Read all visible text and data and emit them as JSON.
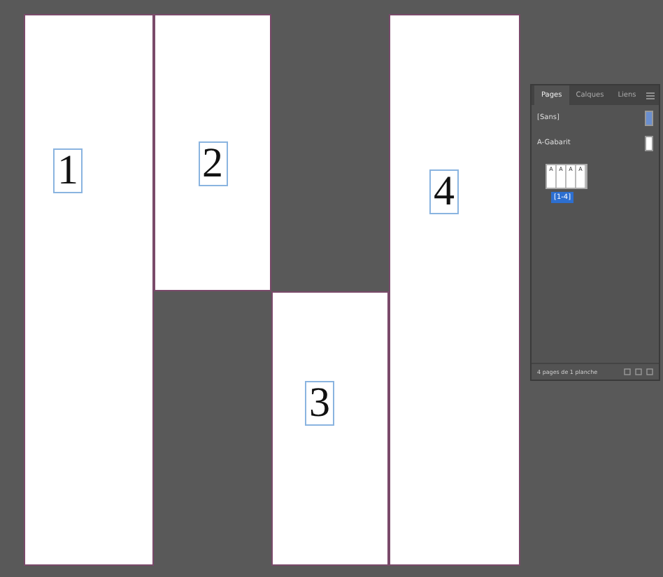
{
  "pages": [
    {
      "number": "1"
    },
    {
      "number": "2"
    },
    {
      "number": "3"
    },
    {
      "number": "4"
    }
  ],
  "panel": {
    "tabs": [
      {
        "label": "Pages",
        "selected": true
      },
      {
        "label": "Calques",
        "selected": false
      },
      {
        "label": "Liens",
        "selected": false
      }
    ],
    "masters": [
      "[Sans]",
      "A-Gabarit"
    ],
    "spread_pages": [
      "A",
      "A",
      "A",
      "A"
    ],
    "spread_label": "[1-4]",
    "status": "4 pages de 1 planche"
  }
}
